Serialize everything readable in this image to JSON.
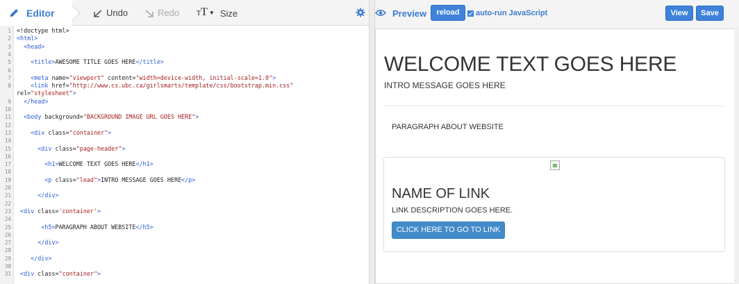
{
  "editor": {
    "title": "Editor",
    "undo_label": "Undo",
    "redo_label": "Redo",
    "size_glyph_small": "T",
    "size_glyph_large": "T",
    "size_label": "Size",
    "lines": [
      {
        "n": "1",
        "html": "&lt;!doctype html&gt;"
      },
      {
        "n": "2",
        "html": "<span class='t'>&lt;html&gt;</span>"
      },
      {
        "n": "3",
        "html": "  <span class='t'>&lt;head&gt;</span>"
      },
      {
        "n": "4",
        "html": ""
      },
      {
        "n": "5",
        "html": "    <span class='t'>&lt;title&gt;</span>AWESOME TITLE GOES HERE<span class='t'>&lt;/title&gt;</span>"
      },
      {
        "n": "6",
        "html": ""
      },
      {
        "n": "7",
        "html": "    <span class='t'>&lt;meta</span> <span class='a'>name=</span><span class='s'>\"viewport\"</span> <span class='a'>content=</span><span class='s'>\"width=device-width, initial-scale=1.0\"</span><span class='t'>&gt;</span>"
      },
      {
        "n": "8",
        "html": "    <span class='t'>&lt;link</span> <span class='a'>href=</span><span class='s'>\"http://www.cs.ubc.ca/girlsmarts/template/css/bootstrap.min.css\"</span>"
      },
      {
        "n": "",
        "html": "<span class='a'>rel=</span><span class='s'>\"stylesheet\"</span><span class='t'>&gt;</span>",
        "wrap": true
      },
      {
        "n": "9",
        "html": "  <span class='t'>&lt;/head&gt;</span>"
      },
      {
        "n": "10",
        "html": ""
      },
      {
        "n": "11",
        "html": "  <span class='t'>&lt;body</span> <span class='a'>background=</span><span class='s'>\"BACKGROUND IMAGE URL GOES HERE\"</span><span class='t'>&gt;</span>"
      },
      {
        "n": "12",
        "html": ""
      },
      {
        "n": "13",
        "html": "    <span class='t'>&lt;div</span> <span class='a'>class=</span><span class='s'>\"container\"</span><span class='t'>&gt;</span>"
      },
      {
        "n": "14",
        "html": ""
      },
      {
        "n": "15",
        "html": "      <span class='t'>&lt;div</span> <span class='a'>class=</span><span class='s'>\"page-header\"</span><span class='t'>&gt;</span>"
      },
      {
        "n": "16",
        "html": ""
      },
      {
        "n": "17",
        "html": "        <span class='t'>&lt;h1&gt;</span>WELCOME TEXT GOES HERE<span class='t'>&lt;/h1&gt;</span>"
      },
      {
        "n": "18",
        "html": ""
      },
      {
        "n": "19",
        "html": "        <span class='t'>&lt;p</span> <span class='a'>class=</span><span class='s'>\"lead\"</span><span class='t'>&gt;</span>INTRO MESSAGE GOES HERE<span class='t'>&lt;/p&gt;</span>"
      },
      {
        "n": "20",
        "html": ""
      },
      {
        "n": "21",
        "html": "      <span class='t'>&lt;/div&gt;</span>"
      },
      {
        "n": "22",
        "html": ""
      },
      {
        "n": "23",
        "html": " <span class='t'>&lt;div</span> <span class='a'>class=</span><span class='s'>'container'</span><span class='t'>&gt;</span>"
      },
      {
        "n": "24",
        "html": ""
      },
      {
        "n": "25",
        "html": "       <span class='t'>&lt;h5&gt;</span>PARAGRAPH ABOUT WEBSITE<span class='t'>&lt;/h5&gt;</span>"
      },
      {
        "n": "26",
        "html": ""
      },
      {
        "n": "27",
        "html": "      <span class='t'>&lt;/div&gt;</span>"
      },
      {
        "n": "28",
        "html": ""
      },
      {
        "n": "29",
        "html": "    <span class='t'>&lt;/div&gt;</span>"
      },
      {
        "n": "30",
        "html": ""
      },
      {
        "n": "31",
        "html": " <span class='t'>&lt;div</span> <span class='a'>class=</span><span class='s'>\"container\"</span><span class='t'>&gt;</span>"
      }
    ]
  },
  "preview": {
    "title": "Preview",
    "reload_label": "reload",
    "autorun_label": "auto-run JavaScript",
    "autorun_checked": true,
    "view_label": "View",
    "save_label": "Save",
    "page": {
      "h1": "WELCOME TEXT GOES HERE",
      "lead": "INTRO MESSAGE GOES HERE",
      "h5": "PARAGRAPH ABOUT WEBSITE",
      "link_title": "NAME OF LINK",
      "link_desc": "LINK DESCRIPTION GOES HERE.",
      "link_button": "CLICK HERE TO GO TO LINK"
    }
  },
  "colors": {
    "accent": "#3c7bd2",
    "button": "#3e82d9",
    "tag": "#2a5bd7",
    "string": "#a71d1d"
  },
  "icons": {
    "editor": "pencil-icon",
    "undo": "undo-arrow-icon",
    "redo": "redo-arrow-icon",
    "size": "text-size-icon",
    "settings": "gear-icon",
    "preview": "eye-icon",
    "image": "broken-image-icon"
  }
}
